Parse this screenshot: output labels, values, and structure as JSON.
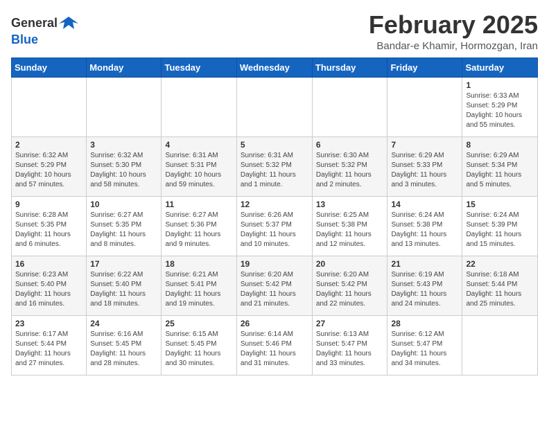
{
  "header": {
    "logo_line1": "General",
    "logo_line2": "Blue",
    "month_title": "February 2025",
    "location": "Bandar-e Khamir, Hormozgan, Iran"
  },
  "days_of_week": [
    "Sunday",
    "Monday",
    "Tuesday",
    "Wednesday",
    "Thursday",
    "Friday",
    "Saturday"
  ],
  "weeks": [
    [
      {
        "day": "",
        "info": ""
      },
      {
        "day": "",
        "info": ""
      },
      {
        "day": "",
        "info": ""
      },
      {
        "day": "",
        "info": ""
      },
      {
        "day": "",
        "info": ""
      },
      {
        "day": "",
        "info": ""
      },
      {
        "day": "1",
        "info": "Sunrise: 6:33 AM\nSunset: 5:29 PM\nDaylight: 10 hours\nand 55 minutes."
      }
    ],
    [
      {
        "day": "2",
        "info": "Sunrise: 6:32 AM\nSunset: 5:29 PM\nDaylight: 10 hours\nand 57 minutes."
      },
      {
        "day": "3",
        "info": "Sunrise: 6:32 AM\nSunset: 5:30 PM\nDaylight: 10 hours\nand 58 minutes."
      },
      {
        "day": "4",
        "info": "Sunrise: 6:31 AM\nSunset: 5:31 PM\nDaylight: 10 hours\nand 59 minutes."
      },
      {
        "day": "5",
        "info": "Sunrise: 6:31 AM\nSunset: 5:32 PM\nDaylight: 11 hours\nand 1 minute."
      },
      {
        "day": "6",
        "info": "Sunrise: 6:30 AM\nSunset: 5:32 PM\nDaylight: 11 hours\nand 2 minutes."
      },
      {
        "day": "7",
        "info": "Sunrise: 6:29 AM\nSunset: 5:33 PM\nDaylight: 11 hours\nand 3 minutes."
      },
      {
        "day": "8",
        "info": "Sunrise: 6:29 AM\nSunset: 5:34 PM\nDaylight: 11 hours\nand 5 minutes."
      }
    ],
    [
      {
        "day": "9",
        "info": "Sunrise: 6:28 AM\nSunset: 5:35 PM\nDaylight: 11 hours\nand 6 minutes."
      },
      {
        "day": "10",
        "info": "Sunrise: 6:27 AM\nSunset: 5:35 PM\nDaylight: 11 hours\nand 8 minutes."
      },
      {
        "day": "11",
        "info": "Sunrise: 6:27 AM\nSunset: 5:36 PM\nDaylight: 11 hours\nand 9 minutes."
      },
      {
        "day": "12",
        "info": "Sunrise: 6:26 AM\nSunset: 5:37 PM\nDaylight: 11 hours\nand 10 minutes."
      },
      {
        "day": "13",
        "info": "Sunrise: 6:25 AM\nSunset: 5:38 PM\nDaylight: 11 hours\nand 12 minutes."
      },
      {
        "day": "14",
        "info": "Sunrise: 6:24 AM\nSunset: 5:38 PM\nDaylight: 11 hours\nand 13 minutes."
      },
      {
        "day": "15",
        "info": "Sunrise: 6:24 AM\nSunset: 5:39 PM\nDaylight: 11 hours\nand 15 minutes."
      }
    ],
    [
      {
        "day": "16",
        "info": "Sunrise: 6:23 AM\nSunset: 5:40 PM\nDaylight: 11 hours\nand 16 minutes."
      },
      {
        "day": "17",
        "info": "Sunrise: 6:22 AM\nSunset: 5:40 PM\nDaylight: 11 hours\nand 18 minutes."
      },
      {
        "day": "18",
        "info": "Sunrise: 6:21 AM\nSunset: 5:41 PM\nDaylight: 11 hours\nand 19 minutes."
      },
      {
        "day": "19",
        "info": "Sunrise: 6:20 AM\nSunset: 5:42 PM\nDaylight: 11 hours\nand 21 minutes."
      },
      {
        "day": "20",
        "info": "Sunrise: 6:20 AM\nSunset: 5:42 PM\nDaylight: 11 hours\nand 22 minutes."
      },
      {
        "day": "21",
        "info": "Sunrise: 6:19 AM\nSunset: 5:43 PM\nDaylight: 11 hours\nand 24 minutes."
      },
      {
        "day": "22",
        "info": "Sunrise: 6:18 AM\nSunset: 5:44 PM\nDaylight: 11 hours\nand 25 minutes."
      }
    ],
    [
      {
        "day": "23",
        "info": "Sunrise: 6:17 AM\nSunset: 5:44 PM\nDaylight: 11 hours\nand 27 minutes."
      },
      {
        "day": "24",
        "info": "Sunrise: 6:16 AM\nSunset: 5:45 PM\nDaylight: 11 hours\nand 28 minutes."
      },
      {
        "day": "25",
        "info": "Sunrise: 6:15 AM\nSunset: 5:45 PM\nDaylight: 11 hours\nand 30 minutes."
      },
      {
        "day": "26",
        "info": "Sunrise: 6:14 AM\nSunset: 5:46 PM\nDaylight: 11 hours\nand 31 minutes."
      },
      {
        "day": "27",
        "info": "Sunrise: 6:13 AM\nSunset: 5:47 PM\nDaylight: 11 hours\nand 33 minutes."
      },
      {
        "day": "28",
        "info": "Sunrise: 6:12 AM\nSunset: 5:47 PM\nDaylight: 11 hours\nand 34 minutes."
      },
      {
        "day": "",
        "info": ""
      }
    ]
  ]
}
